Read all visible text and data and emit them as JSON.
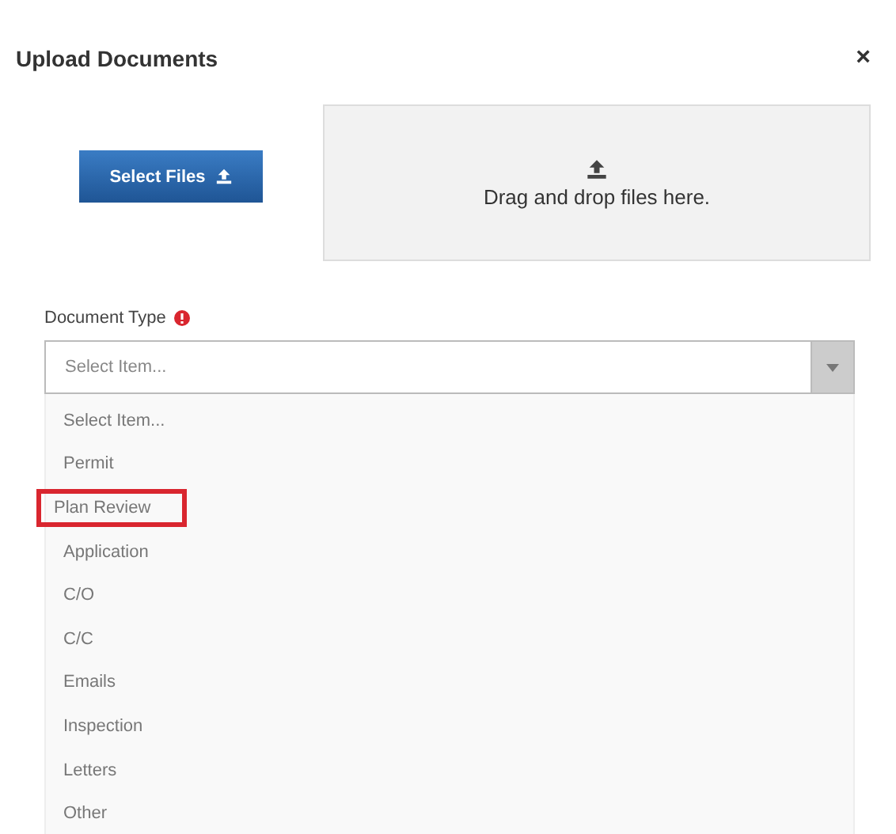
{
  "dialog": {
    "title": "Upload Documents",
    "close": "×"
  },
  "select_button": {
    "label": "Select Files"
  },
  "drop_zone": {
    "text": "Drag and drop files here."
  },
  "document_type": {
    "label": "Document Type",
    "required": true,
    "placeholder": "Select Item...",
    "expanded": true,
    "options": [
      {
        "label": "Select Item...",
        "highlighted": false
      },
      {
        "label": "Permit",
        "highlighted": false
      },
      {
        "label": "Plan Review",
        "highlighted": true
      },
      {
        "label": "Application",
        "highlighted": false
      },
      {
        "label": "C/O",
        "highlighted": false
      },
      {
        "label": "C/C",
        "highlighted": false
      },
      {
        "label": "Emails",
        "highlighted": false
      },
      {
        "label": "Inspection",
        "highlighted": false
      },
      {
        "label": "Letters",
        "highlighted": false
      },
      {
        "label": "Other",
        "highlighted": false
      }
    ]
  }
}
